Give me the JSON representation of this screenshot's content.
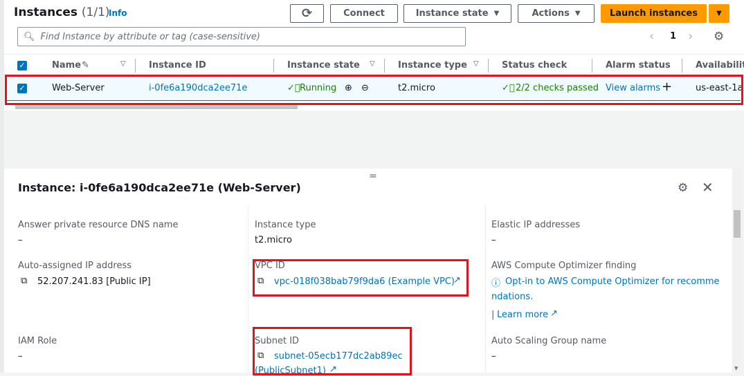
{
  "header": {
    "title": "Instances",
    "count": "(1/1)",
    "info": "Info"
  },
  "toolbar": {
    "refresh_icon": "refresh-icon",
    "connect": "Connect",
    "instance_state": "Instance state",
    "actions": "Actions",
    "launch": "Launch instances"
  },
  "search": {
    "placeholder": "Find Instance by attribute or tag (case-sensitive)"
  },
  "pagination": {
    "page": "1"
  },
  "table": {
    "columns": [
      "Name",
      "Instance ID",
      "Instance state",
      "Instance type",
      "Status check",
      "Alarm status",
      "Availability"
    ],
    "rows": [
      {
        "name": "Web-Server",
        "id": "i-0fe6a190dca2ee71e",
        "state": "Running",
        "type": "t2.micro",
        "status": "2/2 checks passed",
        "alarm": "View alarms",
        "az": "us-east-1a"
      }
    ]
  },
  "detail": {
    "title": "Instance: i-0fe6a190dca2ee71e (Web-Server)",
    "fields": [
      {
        "label": "Answer private resource DNS name",
        "value": "–"
      },
      {
        "label": "Instance type",
        "value": "t2.micro"
      },
      {
        "label": "Elastic IP addresses",
        "value": "–"
      },
      {
        "label": "Auto-assigned IP address",
        "value": "52.207.241.83 [Public IP]"
      },
      {
        "label": "VPC ID",
        "value": "vpc-018f038bab79f9da6 (Example VPC)"
      },
      {
        "label": "AWS Compute Optimizer finding",
        "value": "Opt-in to AWS Compute Optimizer for recomme",
        "value2": "ndations.",
        "extra": "Learn more"
      },
      {
        "label": "IAM Role",
        "value": "–"
      },
      {
        "label": "Subnet ID",
        "value": "subnet-05ecb177dc2ab89ec",
        "value2": "(PublicSubnet1)"
      },
      {
        "label": "Auto Scaling Group name",
        "value": "–"
      }
    ]
  },
  "colors": {
    "accent": "#0073bb",
    "launch": "#ff9900",
    "highlight": "#e0141e",
    "success": "#1d8102"
  }
}
